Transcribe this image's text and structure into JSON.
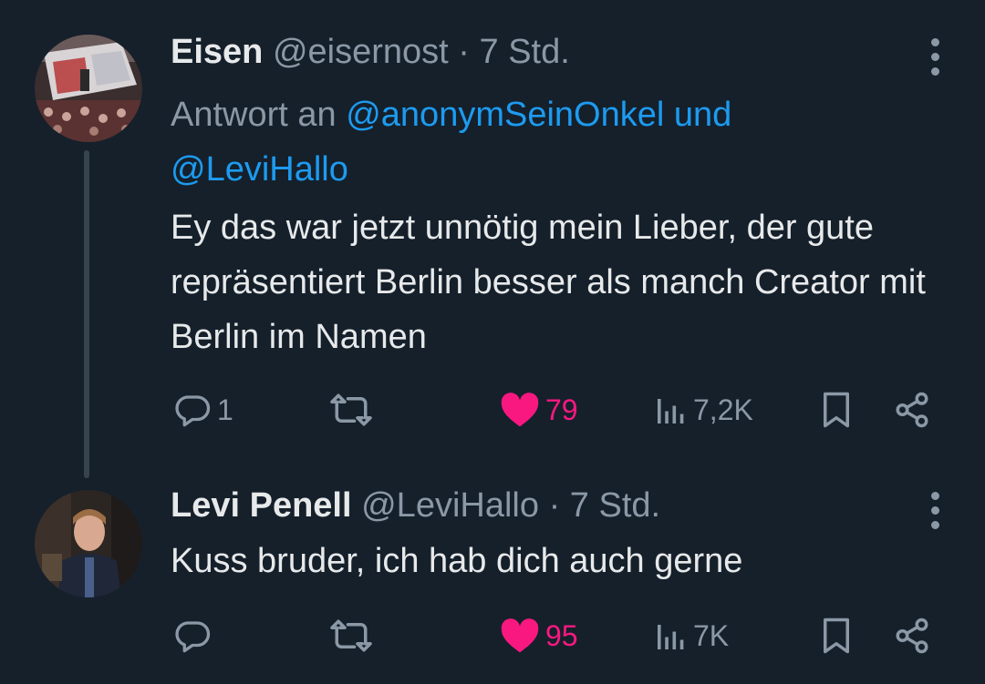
{
  "tweets": [
    {
      "name": "Eisen",
      "handle": "@eisernost",
      "separator": "·",
      "time": "7 Std.",
      "replying_prefix": "Antwort an",
      "replying_mentions": "@anonymSeinOnkel und @LeviHallo",
      "text": "Ey das war jetzt unnötig mein Lieber, der gute repräsentiert Berlin besser als manch Creator mit Berlin im Namen",
      "stats": {
        "replies": "1",
        "retweets": "",
        "likes": "79",
        "views": "7,2K"
      }
    },
    {
      "name": "Levi Penell",
      "handle": "@LeviHallo",
      "separator": "·",
      "time": "7 Std.",
      "text": "Kuss bruder, ich hab dich auch gerne",
      "stats": {
        "replies": "",
        "retweets": "",
        "likes": "95",
        "views": "7K"
      }
    }
  ],
  "colors": {
    "background": "#15202b",
    "text": "#e7e9ea",
    "muted": "#8b98a5",
    "link": "#1d9bf0",
    "like": "#f91880"
  },
  "icons": [
    "reply-icon",
    "retweet-icon",
    "heart-icon",
    "views-icon",
    "bookmark-icon",
    "share-icon",
    "more-icon"
  ]
}
